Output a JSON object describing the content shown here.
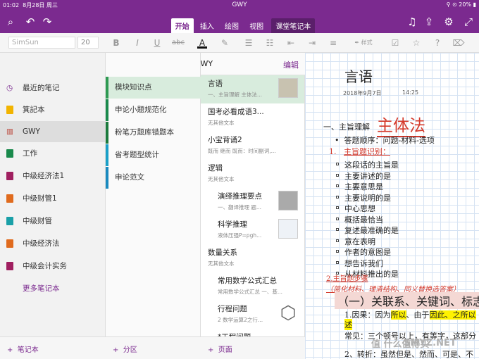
{
  "status": {
    "time": "01:02",
    "date": "8月28日 周三",
    "battery": "20%"
  },
  "app": {
    "title": "GWY"
  },
  "tabs": [
    "开始",
    "插入",
    "绘图",
    "视图",
    "课堂笔记本"
  ],
  "ribbon": {
    "font": "SimSun",
    "size": "20",
    "bold": "B",
    "italic": "I",
    "underline": "U",
    "strike": "abc",
    "style": "样式"
  },
  "notebooks": {
    "items": [
      {
        "label": "最近的笔记",
        "color": "#7b2a8f"
      },
      {
        "label": "箕記本",
        "color": "#f2b400"
      },
      {
        "label": "GWY",
        "color": "#b83a2c"
      },
      {
        "label": "工作",
        "color": "#1a8a4c"
      },
      {
        "label": "中级经济法1",
        "color": "#a02060"
      },
      {
        "label": "中级财管1",
        "color": "#e06b1e"
      },
      {
        "label": "中级财管",
        "color": "#1aa0a8"
      },
      {
        "label": "中级经济法",
        "color": "#e06b1e"
      },
      {
        "label": "中级会计实务",
        "color": "#a02060"
      }
    ],
    "more": "更多笔记本",
    "add": "笔记本"
  },
  "sections": {
    "header": "GWY",
    "edit": "编辑",
    "items": [
      {
        "label": "模块知识点",
        "color": "#2e9a52"
      },
      {
        "label": "申论小题规范化",
        "color": "#1a8a4c"
      },
      {
        "label": "粉笔万题库错题本",
        "color": "#1a7a3c"
      },
      {
        "label": "省考题型统计",
        "color": "#1aa0c8"
      },
      {
        "label": "申论范文",
        "color": "#1a8abf"
      }
    ],
    "add": "分区"
  },
  "pages": {
    "items": [
      {
        "title": "言语",
        "sub": "一、主旨理解 主体法...",
        "indent": false,
        "thumb": true
      },
      {
        "title": "国考必看成语3...",
        "sub": "无其他文本",
        "indent": false,
        "thumb": false
      },
      {
        "title": "小宝背诵2",
        "sub": "既而 继而 既而：时间副词,...",
        "indent": false,
        "thumb": false
      },
      {
        "title": "逻辑",
        "sub": "无其他文本",
        "indent": false,
        "thumb": false
      },
      {
        "title": "演绎推理要点",
        "sub": "一、翻译推理 题...",
        "indent": true,
        "thumb": true
      },
      {
        "title": "科学推理",
        "sub": "液体压强P=pgh...",
        "indent": true,
        "thumb": true
      },
      {
        "title": "数量关系",
        "sub": "无其他文本",
        "indent": false,
        "thumb": false
      },
      {
        "title": "常用数学公式汇总",
        "sub": "常用数学公式汇总 一、基...",
        "indent": true,
        "thumb": false
      },
      {
        "title": "行程问题",
        "sub": "2 数学运算2之行...",
        "indent": true,
        "thumb": true
      },
      {
        "title": "*工程问题",
        "sub": "",
        "indent": true,
        "thumb": false
      }
    ],
    "add": "页面"
  },
  "note": {
    "title": "言语",
    "date": "2018年9月7日",
    "time": "14:25",
    "h1": "一、主旨理解",
    "h1big": "主体法",
    "steps": "答题顺序：问题-材料-选项",
    "n1": "主旨题识别：",
    "bullets": [
      "这段话的主旨是",
      "主要讲述的是",
      "主要意思是",
      "主要说明的是",
      "中心思想",
      "概括最恰当",
      "复述最准确的是",
      "意在表明",
      "作者的意图是",
      "想告诉我们",
      "从材料推出的是"
    ],
    "n2": "2.主旨题步骤",
    "n2sub": "（简化材料、理清结构、同义替换选答案）",
    "box": "（一）关联系、关键词、标志",
    "l1a": "1.因果：因为",
    "l1b": "所以",
    "l1c": "、由于",
    "l1d": "因此",
    "l1e": "、之所以",
    "l1f": "述",
    "l2": "常见：三个顿号以上，有等字，这部分",
    "l3": "2、转折：虽然但是、然而、可是、不"
  },
  "watermark": "值 什么值得买",
  "watermark2": "SMYZ.NET"
}
